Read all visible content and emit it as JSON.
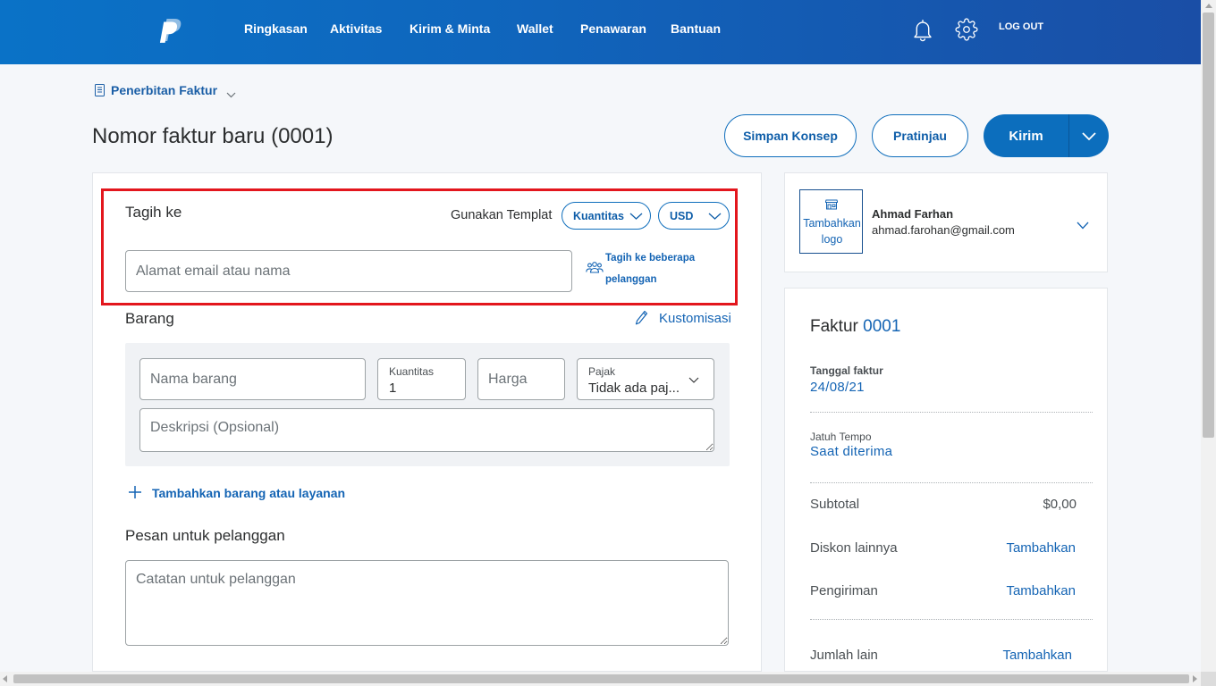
{
  "header": {
    "nav": [
      "Ringkasan",
      "Aktivitas",
      "Kirim & Minta",
      "Wallet",
      "Penawaran",
      "Bantuan"
    ],
    "logout": "LOG OUT"
  },
  "breadcrumb": {
    "label": "Penerbitan Faktur"
  },
  "page": {
    "title": "Nomor faktur baru (0001)"
  },
  "actions": {
    "save_draft": "Simpan Konsep",
    "preview": "Pratinjau",
    "send": "Kirim"
  },
  "bill_to": {
    "title": "Tagih ke",
    "template_label": "Gunakan Templat",
    "template_value": "Kuantitas",
    "currency": "USD",
    "recipient_placeholder": "Alamat email atau nama",
    "multi_customer_link": "Tagih ke beberapa pelanggan"
  },
  "items": {
    "title": "Barang",
    "customize": "Kustomisasi",
    "name_placeholder": "Nama barang",
    "qty_label": "Kuantitas",
    "qty_value": "1",
    "price_placeholder": "Harga",
    "tax_label": "Pajak",
    "tax_value": "Tidak ada paj...",
    "description_placeholder": "Deskripsi (Opsional)",
    "add_item": "Tambahkan barang atau layanan"
  },
  "message": {
    "title": "Pesan untuk pelanggan",
    "placeholder": "Catatan untuk pelanggan"
  },
  "business": {
    "add_logo": "Tambahkan logo",
    "name": "Ahmad Farhan",
    "email": "ahmad.farohan@gmail.com"
  },
  "invoice": {
    "label": "Faktur",
    "number": "0001",
    "date_label": "Tanggal faktur",
    "date_value": "24/08/21",
    "due_label": "Jatuh Tempo",
    "due_value": "Saat diterima",
    "summary": [
      {
        "label": "Subtotal",
        "value": "$0,00"
      },
      {
        "label": "Diskon lainnya",
        "value": "Tambahkan"
      },
      {
        "label": "Pengiriman",
        "value": "Tambahkan"
      },
      {
        "label": "Jumlah lain",
        "value": "Tambahkan"
      }
    ]
  },
  "icons": {
    "logo": "paypal-logo-icon",
    "notifications": "bell-icon",
    "settings": "gear-icon",
    "breadcrumb": "document-icon",
    "dropdown": "chevron-down-icon",
    "multi_customer": "people-icon",
    "customize": "pencil-icon",
    "add": "plus-icon",
    "logo_upload": "store-icon"
  },
  "colors": {
    "header_gradient_start": "#0a72c7",
    "header_gradient_end": "#1a4ea6",
    "primary_button": "#0c6ebd",
    "link": "#1464b4",
    "highlight_border": "#e3161d",
    "page_background": "#f5f7fa"
  }
}
